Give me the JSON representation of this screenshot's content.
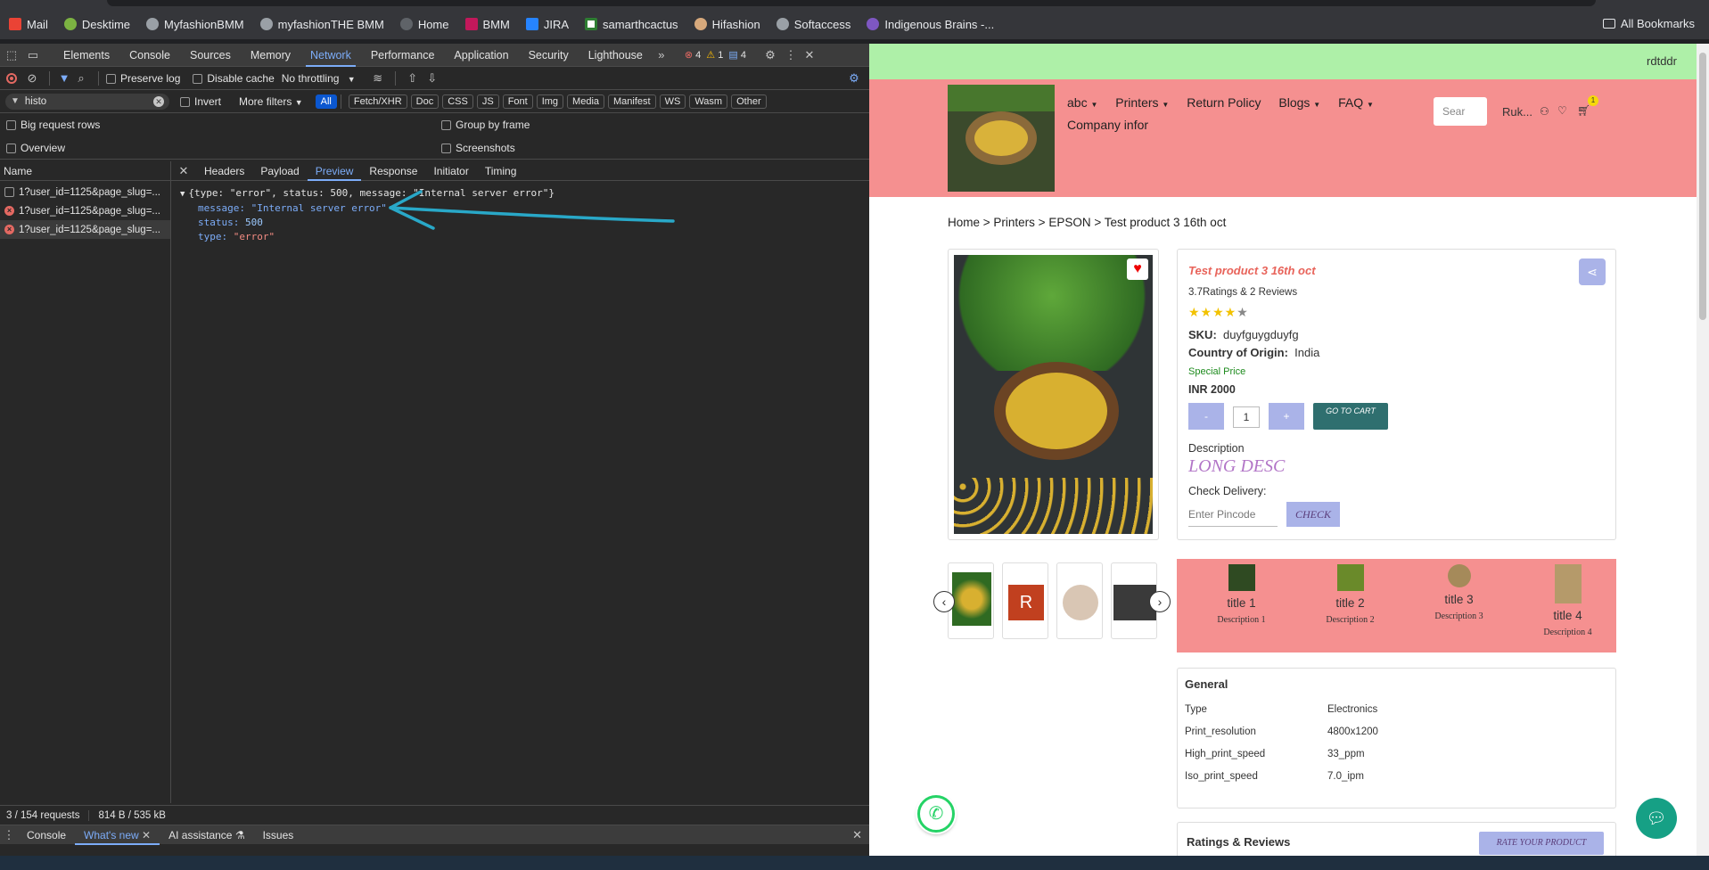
{
  "browser": {
    "bookmarks": [
      "Mail",
      "Desktime",
      "MyfashionBMM",
      "myfashionTHE BMM",
      "Home",
      "BMM",
      "JIRA",
      "samarthcactus",
      "Hifashion",
      "Softaccess",
      "Indigenous Brains -..."
    ],
    "all_bookmarks": "All Bookmarks"
  },
  "devtools": {
    "tabs": [
      "Elements",
      "Console",
      "Sources",
      "Memory",
      "Network",
      "Performance",
      "Application",
      "Security",
      "Lighthouse"
    ],
    "active_tab": "Network",
    "counts": {
      "errors": "4",
      "warnings": "1",
      "messages": "4"
    },
    "preserve_log": "Preserve log",
    "disable_cache": "Disable cache",
    "throttling": "No throttling",
    "filter_value": "histo",
    "invert": "Invert",
    "more_filters": "More filters",
    "type_filters": [
      "All",
      "Fetch/XHR",
      "Doc",
      "CSS",
      "JS",
      "Font",
      "Img",
      "Media",
      "Manifest",
      "WS",
      "Wasm",
      "Other"
    ],
    "big_request_rows": "Big request rows",
    "group_by_frame": "Group by frame",
    "overview": "Overview",
    "screenshots": "Screenshots",
    "name_header": "Name",
    "requests": [
      "1?user_id=1125&page_slug=...",
      "1?user_id=1125&page_slug=...",
      "1?user_id=1125&page_slug=..."
    ],
    "detail_tabs": [
      "Headers",
      "Payload",
      "Preview",
      "Response",
      "Initiator",
      "Timing"
    ],
    "active_detail": "Preview",
    "preview_summary": "{type: \"error\", status: 500, message: \"Internal server error\"}",
    "preview": {
      "message_key": "message:",
      "message_val": "\"Internal server error\"",
      "status_key": "status:",
      "status_val": "500",
      "type_key": "type:",
      "type_val": "\"error\""
    },
    "status_requests": "3 / 154 requests",
    "status_size": "814 B / 535 kB",
    "drawer_tabs": [
      "Console",
      "What's new",
      "AI assistance",
      "Issues"
    ]
  },
  "site": {
    "banner": "rdtddr",
    "nav": [
      "abc",
      "Printers",
      "Return Policy",
      "Blogs",
      "FAQ",
      "Company infor"
    ],
    "search_placeholder": "Sear",
    "user": "Ruk...",
    "cart_count": "1",
    "breadcrumb": [
      "Home",
      "Printers",
      "EPSON",
      "Test product 3 16th oct"
    ],
    "product": {
      "title": "Test product 3 16th oct",
      "ratings": "3.7Ratings & 2 Reviews",
      "rating_value": 3.7,
      "sku_label": "SKU:",
      "sku": "duyfguygduyfg",
      "origin_label": "Country of Origin:",
      "origin": "India",
      "special": "Special Price",
      "price": "INR 2000",
      "qty": "1",
      "minus": "-",
      "plus": "+",
      "go_to_cart": "GO TO CART",
      "desc_label": "Description",
      "desc": "LONG DESC",
      "check_delivery": "Check Delivery:",
      "pincode_placeholder": "Enter Pincode",
      "check": "CHECK"
    },
    "features": [
      {
        "title": "title 1",
        "desc": "Description 1"
      },
      {
        "title": "title 2",
        "desc": "Description 2"
      },
      {
        "title": "title 3",
        "desc": "Description 3"
      },
      {
        "title": "title 4",
        "desc": "Description 4"
      }
    ],
    "thumb_r": "R",
    "general": {
      "heading": "General",
      "rows": [
        [
          "Type",
          "Electronics"
        ],
        [
          "Print_resolution",
          "4800x1200"
        ],
        [
          "High_print_speed",
          "33_ppm"
        ],
        [
          "Iso_print_speed",
          "7.0_ipm"
        ]
      ]
    },
    "ratings_heading": "Ratings & Reviews",
    "rate_button": "RATE YOUR PRODUCT",
    "colors": {
      "banner": "#aef0a8",
      "header": "#f59090",
      "feature_band": "#f59090",
      "accent": "#2f6f6f"
    }
  }
}
